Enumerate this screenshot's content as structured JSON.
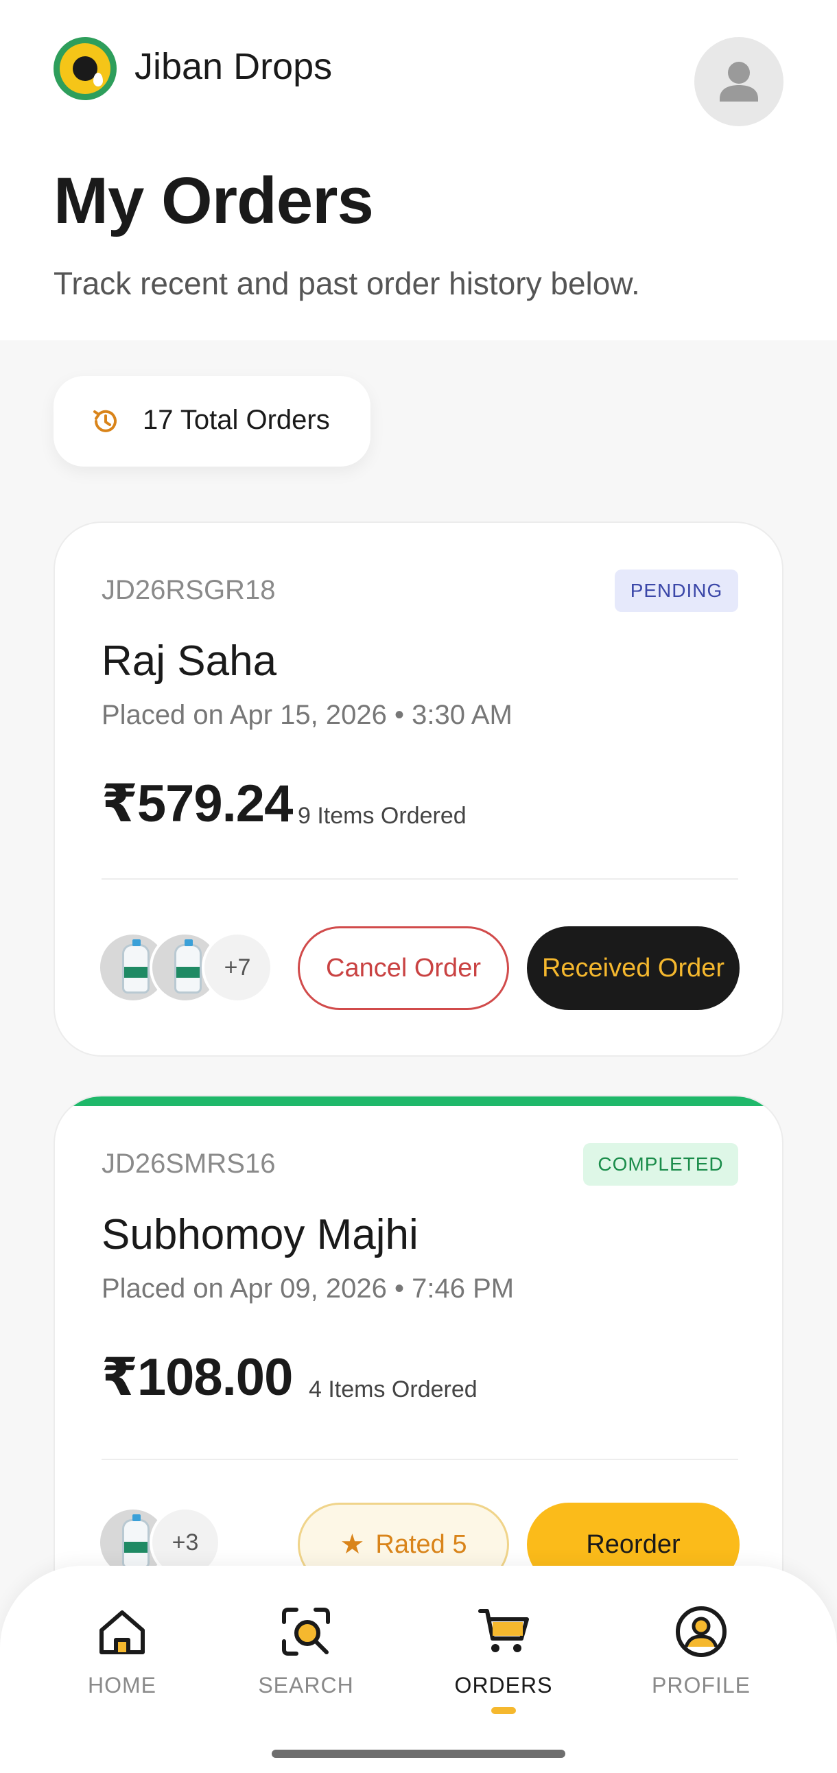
{
  "app": {
    "name": "Jiban Drops"
  },
  "header": {
    "title": "My Orders",
    "subtitle": "Track recent and past order history below."
  },
  "summary": {
    "total_orders_label": "17 Total Orders"
  },
  "orders": [
    {
      "id": "JD26RSGR18",
      "status": "PENDING",
      "customer": "Raj Saha",
      "placed": "Placed on Apr 15, 2026 • 3:30 AM",
      "price": "₹579.24",
      "items": "9 Items Ordered",
      "more_items": "+7",
      "actions": {
        "secondary": "Cancel Order",
        "primary": "Received Order"
      }
    },
    {
      "id": "JD26SMRS16",
      "status": "COMPLETED",
      "customer": "Subhomoy Majhi",
      "placed": "Placed on Apr 09, 2026 • 7:46 PM",
      "price": "₹108.00",
      "items": "4 Items Ordered",
      "more_items": "+3",
      "actions": {
        "secondary": "Rated 5",
        "primary": "Reorder"
      }
    }
  ],
  "nav": {
    "home": "HOME",
    "search": "SEARCH",
    "orders": "ORDERS",
    "profile": "PROFILE",
    "active": "orders"
  },
  "colors": {
    "accent": "#f5b82e",
    "pending_badge": "#e6e9fb",
    "completed_badge": "#def7e7",
    "completed_accent": "#1fb86a",
    "cancel": "#d14b4b"
  }
}
